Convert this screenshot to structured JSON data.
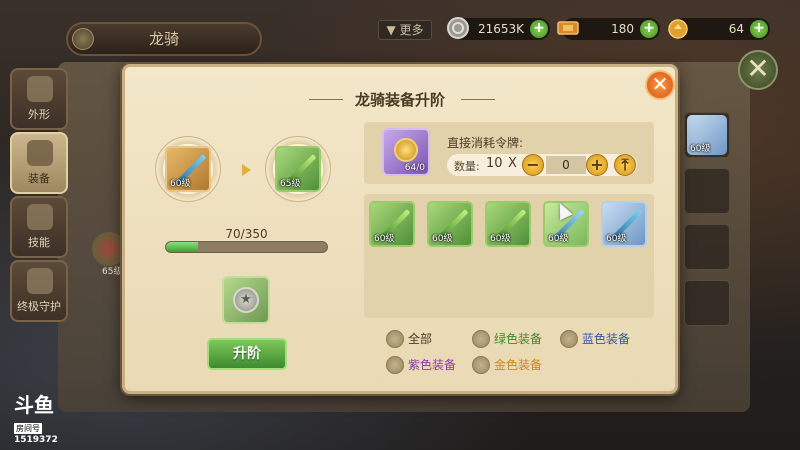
{
  "header": {
    "title": "龙骑",
    "more_label": "更多",
    "resources": [
      {
        "icon": "silver-coin-icon",
        "value": "21653K"
      },
      {
        "icon": "ticket-icon",
        "value": "180"
      },
      {
        "icon": "gold-ingot-icon",
        "value": "64"
      }
    ],
    "plus_label": "+",
    "close_label": "✕"
  },
  "side_tabs": [
    {
      "label": "外形",
      "icon": "dragon-head-icon",
      "active": false
    },
    {
      "label": "装备",
      "icon": "armor-icon",
      "active": true
    },
    {
      "label": "技能",
      "icon": "skill-icon",
      "active": false
    },
    {
      "label": "终极守护",
      "icon": "puzzle-icon",
      "active": false
    }
  ],
  "background": {
    "item_level": "65级",
    "right_slot_level": "60级"
  },
  "dialog": {
    "title": "龙骑装备升阶",
    "close_label": "✕",
    "current_item": {
      "level": "60级",
      "quality": "gold"
    },
    "next_item": {
      "level": "65级",
      "quality": "green"
    },
    "progress": {
      "text": "70/350",
      "current": 70,
      "max": 350
    },
    "token_slot_icon": "coin-star-icon",
    "upgrade_label": "升阶",
    "consume": {
      "label": "直接消耗令牌:",
      "token_count": "64/0",
      "qty_label": "数量:",
      "qty_count": "10",
      "qty_x": "X",
      "qty_value": "0",
      "minus_label": "−",
      "plus_label": "+",
      "max_label": "⤒"
    },
    "materials": [
      {
        "level": "60级",
        "quality": "green"
      },
      {
        "level": "60级",
        "quality": "green"
      },
      {
        "level": "60级",
        "quality": "green"
      },
      {
        "level": "60级",
        "quality": "green-light"
      },
      {
        "level": "60级",
        "quality": "blue"
      }
    ],
    "filters": [
      {
        "label": "全部",
        "color": "#4a3a26"
      },
      {
        "label": "绿色装备",
        "color": "#3e8a2a"
      },
      {
        "label": "蓝色装备",
        "color": "#2c5aa8"
      },
      {
        "label": "紫色装备",
        "color": "#8a3ab0"
      },
      {
        "label": "金色装备",
        "color": "#c88a10"
      }
    ]
  },
  "watermark": {
    "logo": "斗鱼",
    "room_label": "房间号",
    "room_id": "1519372"
  }
}
